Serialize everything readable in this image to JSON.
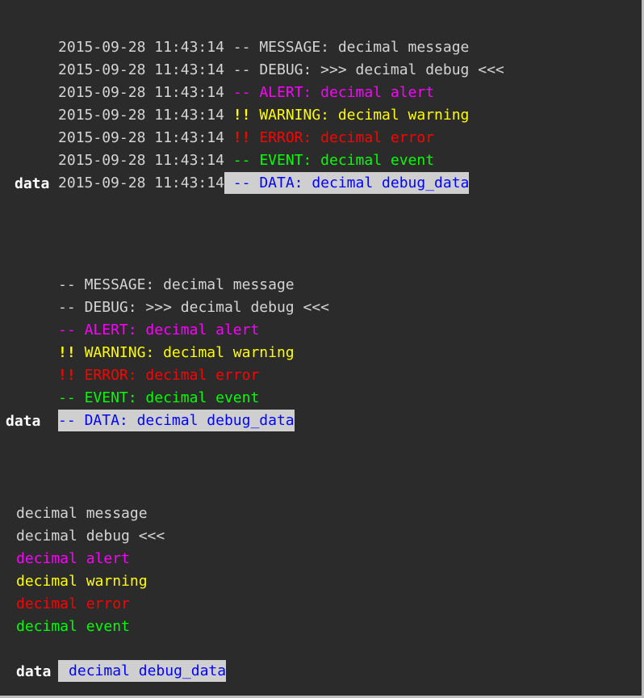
{
  "block1": {
    "timestamp": "2015-09-28 11:43:14",
    "lines": [
      {
        "prefix": "--",
        "label": "MESSAGE: decimal message"
      },
      {
        "prefix": "--",
        "label": "DEBUG: >>> decimal debug <<<"
      },
      {
        "prefix": "--",
        "label": "ALERT: decimal alert"
      },
      {
        "prefix": "!!",
        "label": "WARNING: decimal warning"
      },
      {
        "prefix": "!!",
        "label": "ERROR: decimal error"
      },
      {
        "prefix": "--",
        "label": "EVENT: decimal event"
      },
      {
        "prefix": "--",
        "label": "DATA: decimal debug_data"
      }
    ],
    "trailer": "data"
  },
  "block2": {
    "lines": [
      {
        "prefix": "--",
        "label": "MESSAGE: decimal message"
      },
      {
        "prefix": "--",
        "label": "DEBUG: >>> decimal debug <<<"
      },
      {
        "prefix": "--",
        "label": "ALERT: decimal alert"
      },
      {
        "prefix": "!!",
        "label": "WARNING: decimal warning"
      },
      {
        "prefix": "!!",
        "label": "ERROR: decimal error"
      },
      {
        "prefix": "--",
        "label": "EVENT: decimal event"
      },
      {
        "prefix": "--",
        "label": "DATA: decimal debug_data"
      }
    ],
    "trailer": "data"
  },
  "block3": {
    "lines": [
      {
        "label": "decimal message"
      },
      {
        "label": "decimal debug <<<"
      },
      {
        "label": "decimal alert"
      },
      {
        "label": "decimal warning"
      },
      {
        "label": "decimal error"
      },
      {
        "label": "decimal event"
      },
      {
        "label": "decimal debug_data"
      }
    ],
    "trailer": "data"
  },
  "colors": {
    "background": "#2b2b2b",
    "message": "#d4d4d4",
    "debug": "#d4d4d4",
    "alert": "#ff00ff",
    "warning": "#ffff00",
    "error": "#ff0000",
    "event": "#00ff00",
    "data": "#0000ff",
    "data_highlight": "#cfcfcf"
  }
}
